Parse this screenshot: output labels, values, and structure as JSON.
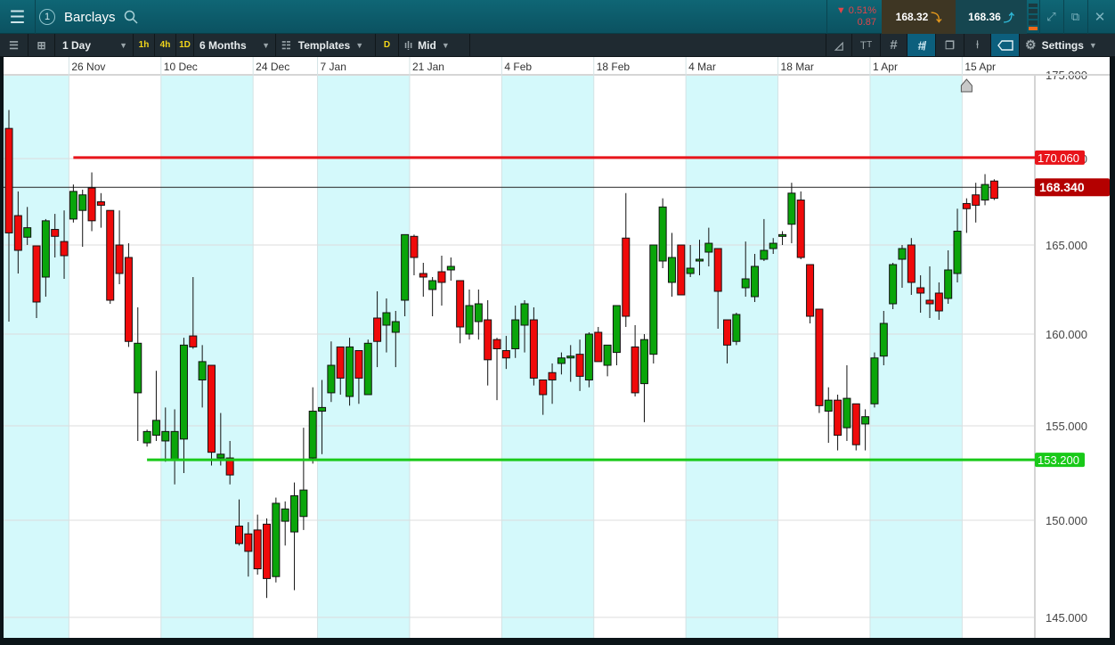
{
  "header": {
    "instrument": "Barclays",
    "window_number": "1",
    "change_percent": "0.51%",
    "change_value": "0.87",
    "sell_price": "168.32",
    "buy_price": "168.36"
  },
  "toolbar": {
    "interval": "1 Day",
    "quick_1h": "1h",
    "quick_4h": "4h",
    "quick_1d": "1D",
    "range": "6 Months",
    "templates": "Templates",
    "d_button": "D",
    "price_type": "Mid",
    "settings": "Settings"
  },
  "colors": {
    "up": "#0aa50a",
    "down": "#ef0a0a",
    "band": "#d4f9fb",
    "resistance": "#e8141a",
    "support": "#19c919",
    "last": "#b40000"
  },
  "chart_data": {
    "type": "candlestick",
    "x_labels": [
      {
        "index": 7,
        "label": "26 Nov"
      },
      {
        "index": 17,
        "label": "10 Dec"
      },
      {
        "index": 27,
        "label": "24 Dec"
      },
      {
        "index": 34,
        "label": "7 Jan"
      },
      {
        "index": 44,
        "label": "21 Jan"
      },
      {
        "index": 54,
        "label": "4 Feb"
      },
      {
        "index": 64,
        "label": "18 Feb"
      },
      {
        "index": 74,
        "label": "4 Mar"
      },
      {
        "index": 84,
        "label": "18 Mar"
      },
      {
        "index": 94,
        "label": "1 Apr"
      },
      {
        "index": 104,
        "label": "15 Apr"
      }
    ],
    "y_ticks": [
      "175.000",
      "170.000",
      "165.000",
      "160.000",
      "155.000",
      "150.000",
      "145.000"
    ],
    "ylim": [
      145,
      175
    ],
    "ohlc": [
      [
        171.8,
        172.9,
        160.7,
        165.7
      ],
      [
        166.7,
        168.1,
        163.4,
        164.7
      ],
      [
        165.45,
        167.2,
        165.0,
        166.0
      ],
      [
        164.95,
        164.95,
        160.9,
        161.8
      ],
      [
        163.2,
        166.5,
        162.1,
        166.4
      ],
      [
        165.9,
        166.8,
        164.3,
        165.5
      ],
      [
        165.2,
        167.0,
        163.1,
        164.4
      ],
      [
        166.5,
        168.5,
        166.3,
        168.1
      ],
      [
        167.0,
        168.2,
        164.9,
        167.9
      ],
      [
        168.3,
        169.2,
        165.8,
        166.4
      ],
      [
        167.5,
        168.0,
        166.0,
        167.3
      ],
      [
        167.0,
        167.0,
        161.7,
        161.9
      ],
      [
        165.0,
        167.0,
        162.8,
        163.4
      ],
      [
        164.3,
        165.1,
        159.3,
        159.6
      ],
      [
        156.8,
        161.5,
        154.2,
        159.5
      ],
      [
        154.1,
        154.8,
        153.9,
        154.7
      ],
      [
        154.5,
        158.0,
        154.2,
        155.3
      ],
      [
        154.2,
        156.0,
        153.1,
        154.7
      ],
      [
        153.2,
        155.9,
        151.9,
        154.7
      ],
      [
        154.3,
        159.8,
        152.5,
        159.4
      ],
      [
        159.9,
        163.2,
        159.2,
        159.3
      ],
      [
        157.5,
        159.4,
        156.0,
        158.5
      ],
      [
        158.3,
        158.3,
        152.9,
        153.6
      ],
      [
        153.3,
        155.7,
        152.9,
        153.5
      ],
      [
        153.3,
        154.2,
        151.9,
        152.4
      ],
      [
        149.7,
        151.1,
        148.7,
        148.8
      ],
      [
        149.3,
        149.9,
        147.1,
        148.4
      ],
      [
        149.5,
        150.3,
        147.2,
        147.5
      ],
      [
        149.8,
        150.1,
        146.0,
        147.0
      ],
      [
        147.1,
        151.2,
        146.8,
        150.9
      ],
      [
        149.95,
        151.0,
        148.7,
        150.6
      ],
      [
        149.4,
        152.0,
        146.4,
        151.3
      ],
      [
        150.2,
        154.9,
        149.5,
        151.6
      ],
      [
        153.3,
        157.1,
        153.0,
        155.8
      ],
      [
        155.8,
        157.5,
        153.5,
        156.0
      ],
      [
        156.8,
        159.6,
        156.3,
        158.3
      ],
      [
        159.3,
        159.3,
        156.7,
        157.6
      ],
      [
        156.6,
        159.8,
        156.1,
        159.3
      ],
      [
        159.1,
        159.1,
        156.2,
        157.6
      ],
      [
        156.7,
        159.7,
        156.7,
        159.5
      ],
      [
        160.9,
        162.4,
        158.2,
        159.6
      ],
      [
        160.5,
        162.0,
        159.0,
        161.2
      ],
      [
        160.1,
        161.3,
        158.2,
        160.7
      ],
      [
        161.9,
        165.6,
        161.0,
        165.6
      ],
      [
        165.5,
        165.6,
        163.3,
        164.3
      ],
      [
        163.4,
        164.0,
        162.1,
        163.2
      ],
      [
        162.5,
        163.2,
        161.0,
        163.0
      ],
      [
        163.5,
        164.4,
        161.6,
        162.9
      ],
      [
        163.6,
        164.3,
        163.0,
        163.8
      ],
      [
        163.0,
        163.0,
        159.5,
        160.4
      ],
      [
        160.0,
        162.5,
        159.7,
        161.6
      ],
      [
        160.7,
        162.5,
        159.7,
        161.7
      ],
      [
        160.8,
        161.9,
        157.2,
        158.6
      ],
      [
        159.7,
        159.8,
        156.4,
        159.2
      ],
      [
        159.1,
        159.9,
        158.1,
        158.7
      ],
      [
        159.2,
        161.6,
        158.7,
        160.8
      ],
      [
        160.5,
        161.9,
        159.0,
        161.7
      ],
      [
        160.8,
        161.5,
        157.2,
        157.6
      ],
      [
        157.5,
        157.5,
        155.6,
        156.7
      ],
      [
        157.9,
        158.4,
        156.2,
        157.5
      ],
      [
        158.4,
        159.0,
        157.8,
        158.7
      ],
      [
        158.7,
        159.4,
        157.4,
        158.8
      ],
      [
        158.9,
        159.7,
        156.9,
        157.7
      ],
      [
        157.5,
        160.1,
        157.1,
        160.0
      ],
      [
        160.1,
        160.4,
        158.5,
        158.5
      ],
      [
        158.3,
        159.4,
        157.7,
        159.4
      ],
      [
        159.0,
        161.6,
        158.3,
        161.6
      ],
      [
        165.4,
        168.0,
        160.4,
        161.0
      ],
      [
        159.3,
        160.5,
        156.6,
        156.8
      ],
      [
        157.3,
        160.0,
        155.2,
        159.7
      ],
      [
        158.9,
        165.0,
        158.4,
        165.0
      ],
      [
        164.1,
        167.7,
        163.7,
        167.2
      ],
      [
        162.9,
        165.7,
        162.1,
        164.3
      ],
      [
        165.0,
        165.0,
        162.2,
        162.2
      ],
      [
        163.4,
        165.0,
        163.2,
        163.7
      ],
      [
        164.1,
        165.3,
        163.3,
        164.2
      ],
      [
        164.6,
        166.0,
        163.8,
        165.1
      ],
      [
        164.8,
        164.8,
        160.3,
        162.4
      ],
      [
        160.8,
        160.8,
        158.4,
        159.4
      ],
      [
        159.6,
        161.2,
        159.4,
        161.1
      ],
      [
        162.6,
        165.2,
        162.1,
        163.1
      ],
      [
        162.1,
        164.5,
        161.8,
        163.8
      ],
      [
        164.2,
        166.5,
        164.1,
        164.7
      ],
      [
        164.8,
        165.4,
        164.5,
        165.1
      ],
      [
        165.5,
        165.8,
        165.0,
        165.6
      ],
      [
        166.2,
        168.6,
        165.1,
        168.0
      ],
      [
        167.6,
        168.1,
        164.2,
        164.3
      ],
      [
        163.9,
        163.9,
        160.6,
        161.0
      ],
      [
        161.4,
        161.4,
        155.7,
        156.1
      ],
      [
        155.8,
        157.1,
        154.1,
        156.4
      ],
      [
        156.4,
        156.7,
        153.7,
        154.5
      ],
      [
        154.9,
        158.3,
        154.2,
        156.5
      ],
      [
        156.2,
        156.2,
        153.7,
        154.0
      ],
      [
        155.1,
        155.9,
        153.7,
        155.5
      ],
      [
        156.2,
        159.0,
        156.0,
        158.7
      ],
      [
        158.8,
        161.3,
        158.3,
        160.6
      ],
      [
        161.7,
        164.0,
        161.4,
        163.9
      ],
      [
        164.2,
        165.0,
        162.6,
        164.8
      ],
      [
        165.0,
        165.4,
        162.2,
        162.9
      ],
      [
        162.6,
        163.3,
        161.2,
        162.3
      ],
      [
        161.9,
        163.8,
        160.9,
        161.7
      ],
      [
        162.3,
        162.9,
        160.8,
        161.3
      ],
      [
        162.0,
        164.7,
        161.7,
        163.6
      ],
      [
        163.4,
        167.1,
        162.9,
        165.8
      ],
      [
        167.4,
        167.7,
        165.7,
        167.1
      ],
      [
        167.9,
        168.6,
        166.3,
        167.3
      ],
      [
        167.6,
        169.1,
        167.3,
        168.5
      ],
      [
        168.7,
        168.8,
        167.6,
        167.7
      ]
    ],
    "lines": [
      {
        "name": "resistance",
        "value": 170.06,
        "label": "170.060",
        "start_index": 7
      },
      {
        "name": "support",
        "value": 153.2,
        "label": "153.200",
        "start_index": 15
      },
      {
        "name": "last-price",
        "value": 168.34,
        "label": "168.340",
        "start_index": 0
      }
    ]
  }
}
